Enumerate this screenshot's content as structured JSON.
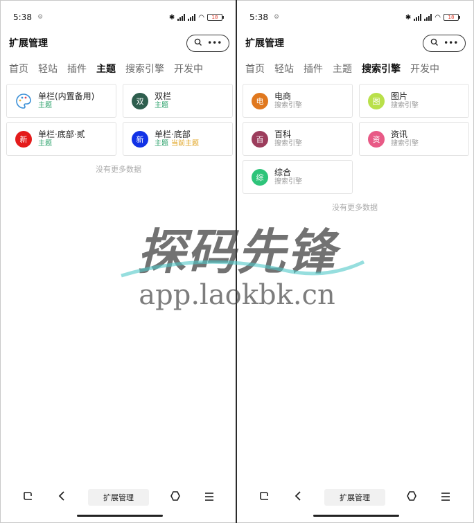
{
  "left": {
    "status": {
      "time": "5:38",
      "battery": "18"
    },
    "header": {
      "title": "扩展管理"
    },
    "tabs": [
      {
        "label": "首页",
        "active": false
      },
      {
        "label": "轻站",
        "active": false
      },
      {
        "label": "插件",
        "active": false
      },
      {
        "label": "主题",
        "active": true
      },
      {
        "label": "搜索引擎",
        "active": false
      },
      {
        "label": "开发中",
        "active": false
      }
    ],
    "cards": [
      {
        "avatar": "",
        "name": "单栏(内置备用)",
        "sub": "主题",
        "current": "",
        "color": "#ffffff"
      },
      {
        "avatar": "双",
        "name": "双栏",
        "sub": "主题",
        "current": "",
        "color": "#2e5e4e"
      },
      {
        "avatar": "新",
        "name": "单栏·底部·贰",
        "sub": "主题",
        "current": "",
        "color": "#e41b1b"
      },
      {
        "avatar": "新",
        "name": "单栏·底部",
        "sub": "主题",
        "current": "当前主题",
        "color": "#1232e6"
      }
    ],
    "no_more": "没有更多数据",
    "bottom_label": "扩展管理"
  },
  "right": {
    "status": {
      "time": "5:38",
      "battery": "18"
    },
    "header": {
      "title": "扩展管理"
    },
    "tabs": [
      {
        "label": "首页",
        "active": false
      },
      {
        "label": "轻站",
        "active": false
      },
      {
        "label": "插件",
        "active": false
      },
      {
        "label": "主题",
        "active": false
      },
      {
        "label": "搜索引擎",
        "active": true
      },
      {
        "label": "开发中",
        "active": false
      }
    ],
    "cards": [
      {
        "avatar": "电",
        "name": "电商",
        "sub": "搜索引擎",
        "color": "#e0781e"
      },
      {
        "avatar": "图",
        "name": "图片",
        "sub": "搜索引擎",
        "color": "#b9e04a"
      },
      {
        "avatar": "百",
        "name": "百科",
        "sub": "搜索引擎",
        "color": "#9c3d5c"
      },
      {
        "avatar": "资",
        "name": "资讯",
        "sub": "搜索引擎",
        "color": "#e85a86"
      },
      {
        "avatar": "综",
        "name": "综合",
        "sub": "搜索引擎",
        "color": "#2ec47a"
      }
    ],
    "no_more": "没有更多数据",
    "bottom_label": "扩展管理"
  },
  "watermark": {
    "title": "探码先锋",
    "url": "app.laokbk.cn"
  }
}
